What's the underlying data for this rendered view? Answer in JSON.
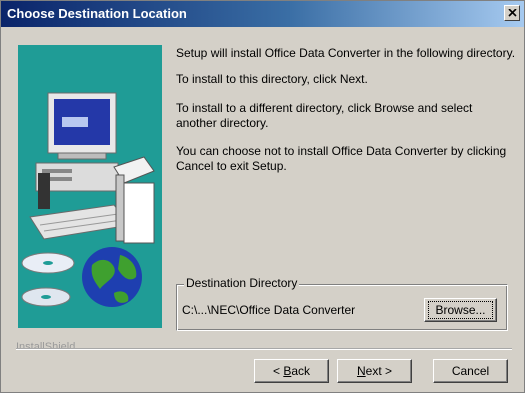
{
  "window": {
    "title": "Choose Destination Location"
  },
  "content": {
    "p1": "Setup will install Office Data Converter in the following directory.",
    "p2": "To install to this directory, click Next.",
    "p3": "To install to a different directory, click Browse and select another directory.",
    "p4": "You can choose not to install Office Data Converter by clicking Cancel to exit Setup."
  },
  "destination": {
    "legend": "Destination Directory",
    "path": "C:\\...\\NEC\\Office Data Converter",
    "browse_label": "Browse..."
  },
  "footer": {
    "brand": "InstallShield",
    "back_prefix": "< ",
    "back_mnemonic": "B",
    "back_rest": "ack",
    "next_mnemonic": "N",
    "next_rest": "ext >",
    "cancel_label": "Cancel"
  },
  "colors": {
    "titlebar_start": "#0a246a",
    "art_background": "#1f9c96",
    "dialog_face": "#d4d0c8"
  },
  "icons": {
    "close": "close-icon",
    "art": "computer-cd-globe-illustration"
  }
}
